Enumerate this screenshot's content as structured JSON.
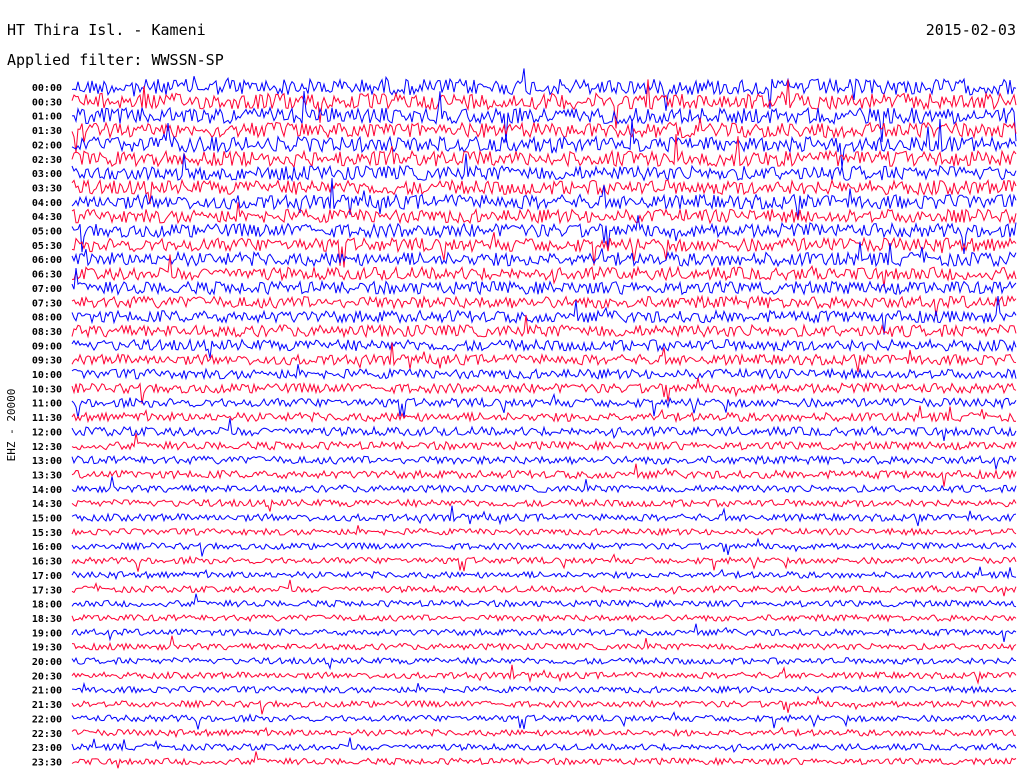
{
  "header": {
    "station": "HT Thira Isl. - Kameni",
    "date": "2015-02-03",
    "filter": "Applied filter: WWSSN-SP"
  },
  "chart_data": {
    "type": "line",
    "title": "HT Thira Isl. - Kameni",
    "ylabel": "EHZ - 20000",
    "line_labels": [
      "00:00",
      "00:30",
      "01:00",
      "01:30",
      "02:00",
      "02:30",
      "03:00",
      "03:30",
      "04:00",
      "04:30",
      "05:00",
      "05:30",
      "06:00",
      "06:30",
      "07:00",
      "07:30",
      "08:00",
      "08:30",
      "09:00",
      "09:30",
      "10:00",
      "10:30",
      "11:00",
      "11:30",
      "12:00",
      "12:30",
      "13:00",
      "13:30",
      "14:00",
      "14:30",
      "15:00",
      "15:30",
      "16:00",
      "16:30",
      "17:00",
      "17:30",
      "18:00",
      "18:30",
      "19:00",
      "19:30",
      "20:00",
      "20:30",
      "21:00",
      "21:30",
      "22:00",
      "22:30",
      "23:00",
      "23:30"
    ],
    "series_colors": [
      "#0000ff",
      "#ff0033"
    ],
    "relative_amplitude": [
      1.0,
      1.0,
      1.0,
      0.95,
      0.95,
      0.95,
      0.9,
      0.9,
      0.9,
      0.85,
      0.85,
      0.85,
      0.85,
      0.8,
      0.8,
      0.75,
      0.75,
      0.75,
      0.7,
      0.65,
      0.6,
      0.6,
      0.55,
      0.55,
      0.55,
      0.5,
      0.5,
      0.5,
      0.45,
      0.45,
      0.45,
      0.4,
      0.4,
      0.4,
      0.4,
      0.4,
      0.4,
      0.4,
      0.4,
      0.4,
      0.4,
      0.4,
      0.4,
      0.4,
      0.4,
      0.4,
      0.4,
      0.4
    ],
    "grid": false
  }
}
